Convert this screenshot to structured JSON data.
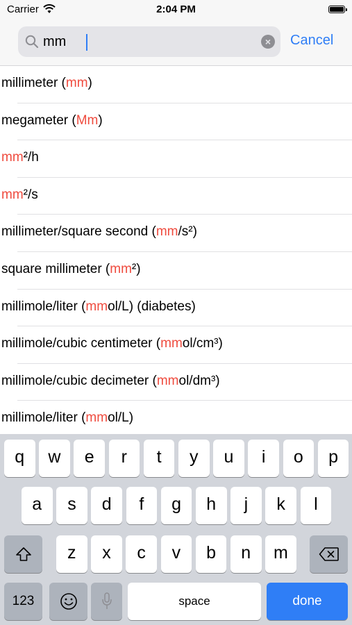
{
  "status": {
    "carrier": "Carrier",
    "time": "2:04 PM"
  },
  "search": {
    "value": "mm",
    "cancel_label": "Cancel"
  },
  "results": [
    {
      "parts": [
        [
          "millimeter (",
          false
        ],
        [
          "mm",
          true
        ],
        [
          ")",
          false
        ]
      ]
    },
    {
      "parts": [
        [
          "megameter (",
          false
        ],
        [
          "Mm",
          true
        ],
        [
          ")",
          false
        ]
      ]
    },
    {
      "parts": [
        [
          "mm",
          true
        ],
        [
          "²/h",
          false
        ]
      ]
    },
    {
      "parts": [
        [
          "mm",
          true
        ],
        [
          "²/s",
          false
        ]
      ]
    },
    {
      "parts": [
        [
          "millimeter/square second (",
          false
        ],
        [
          "mm",
          true
        ],
        [
          "/s²)",
          false
        ]
      ]
    },
    {
      "parts": [
        [
          "square millimeter (",
          false
        ],
        [
          "mm",
          true
        ],
        [
          "²)",
          false
        ]
      ]
    },
    {
      "parts": [
        [
          "millimole/liter (",
          false
        ],
        [
          "mm",
          true
        ],
        [
          "ol/L) (diabetes)",
          false
        ]
      ]
    },
    {
      "parts": [
        [
          "millimole/cubic centimeter (",
          false
        ],
        [
          "mm",
          true
        ],
        [
          "ol/cm³)",
          false
        ]
      ]
    },
    {
      "parts": [
        [
          "millimole/cubic decimeter (",
          false
        ],
        [
          "mm",
          true
        ],
        [
          "ol/dm³)",
          false
        ]
      ]
    },
    {
      "parts": [
        [
          "millimole/liter (",
          false
        ],
        [
          "mm",
          true
        ],
        [
          "ol/L)",
          false
        ]
      ]
    }
  ],
  "keyboard": {
    "row1": [
      "q",
      "w",
      "e",
      "r",
      "t",
      "y",
      "u",
      "i",
      "o",
      "p"
    ],
    "row2": [
      "a",
      "s",
      "d",
      "f",
      "g",
      "h",
      "j",
      "k",
      "l"
    ],
    "row3": [
      "z",
      "x",
      "c",
      "v",
      "b",
      "n",
      "m"
    ],
    "numbers_label": "123",
    "space_label": "space",
    "done_label": "done"
  },
  "colors": {
    "accent": "#2f7ef6",
    "highlight": "#ef4b3e",
    "keyboard_bg": "#d2d5db"
  },
  "icons": [
    "wifi-icon",
    "battery-icon",
    "search-icon",
    "clear-icon",
    "shift-icon",
    "delete-icon",
    "emoji-icon",
    "microphone-icon"
  ]
}
